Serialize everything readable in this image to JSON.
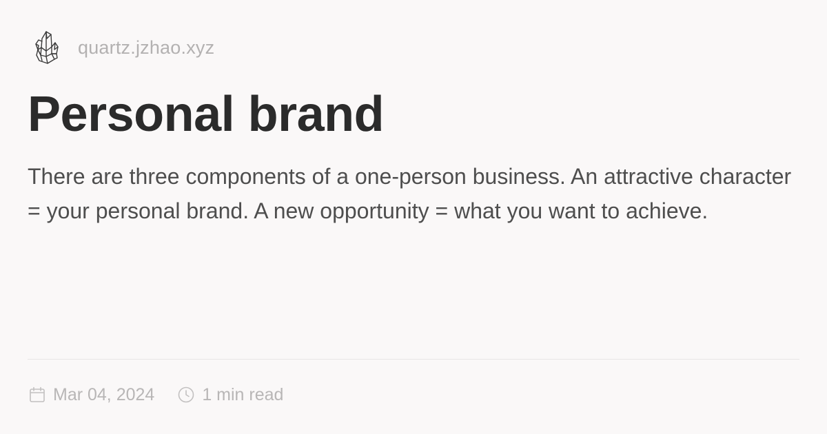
{
  "site": {
    "name": "quartz.jzhao.xyz",
    "logo_icon": "crystal-icon"
  },
  "page": {
    "title": "Personal brand",
    "description": "There are three components of a one-person business. An attractive character = your personal brand. A new opportunity = what you want to achieve."
  },
  "meta": {
    "date": "Mar 04, 2024",
    "date_icon": "calendar-icon",
    "read_time": "1 min read",
    "read_time_icon": "clock-icon"
  },
  "colors": {
    "background": "#faf8f8",
    "title": "#2b2b2b",
    "body_text": "#4e4e4e",
    "muted": "#b3b1b1"
  }
}
